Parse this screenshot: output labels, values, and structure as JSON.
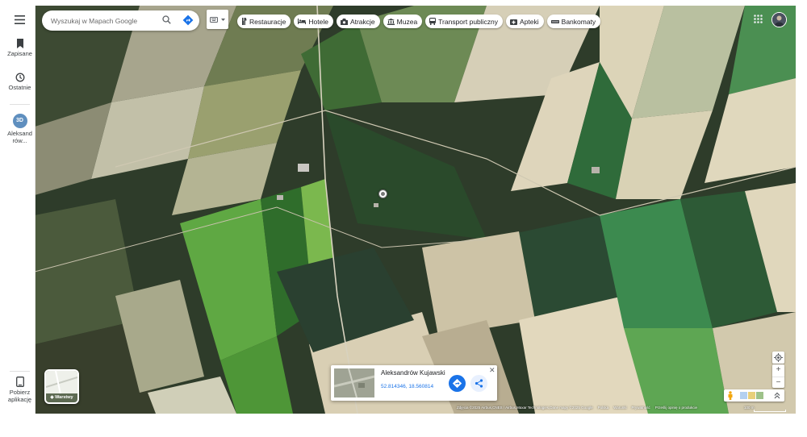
{
  "search": {
    "placeholder": "Wyszukaj w Mapach Google"
  },
  "rail": {
    "saved_label": "Zapisane",
    "recent_label": "Ostatnie",
    "place_label": "Aleksand rów...",
    "download_label": "Pobierz aplikację"
  },
  "chips": [
    {
      "label": "Restauracje",
      "icon": "restaurant-icon"
    },
    {
      "label": "Hotele",
      "icon": "hotel-icon"
    },
    {
      "label": "Atrakcje",
      "icon": "camera-icon"
    },
    {
      "label": "Muzea",
      "icon": "museum-icon"
    },
    {
      "label": "Transport publiczny",
      "icon": "transit-icon"
    },
    {
      "label": "Apteki",
      "icon": "pharmacy-icon"
    },
    {
      "label": "Bankomaty",
      "icon": "atm-icon"
    }
  ],
  "layers": {
    "label": "Warstwy"
  },
  "card": {
    "title": "Aleksandrów Kujawski",
    "coords": "52.814346, 18.560814"
  },
  "attribution": {
    "imagery": "Zdjęcia ©2025 Airbus,CNES / Airbus,Maxar Technologies,Dane mapy ©2025 Google",
    "country": "Polska",
    "terms": "Warunki",
    "privacy": "Prywatność",
    "feedback": "Prześlij opinię o produkcie",
    "scale": "100 m"
  },
  "colors": {
    "accent": "#1a73e8",
    "rail_bg": "#ffffff"
  }
}
